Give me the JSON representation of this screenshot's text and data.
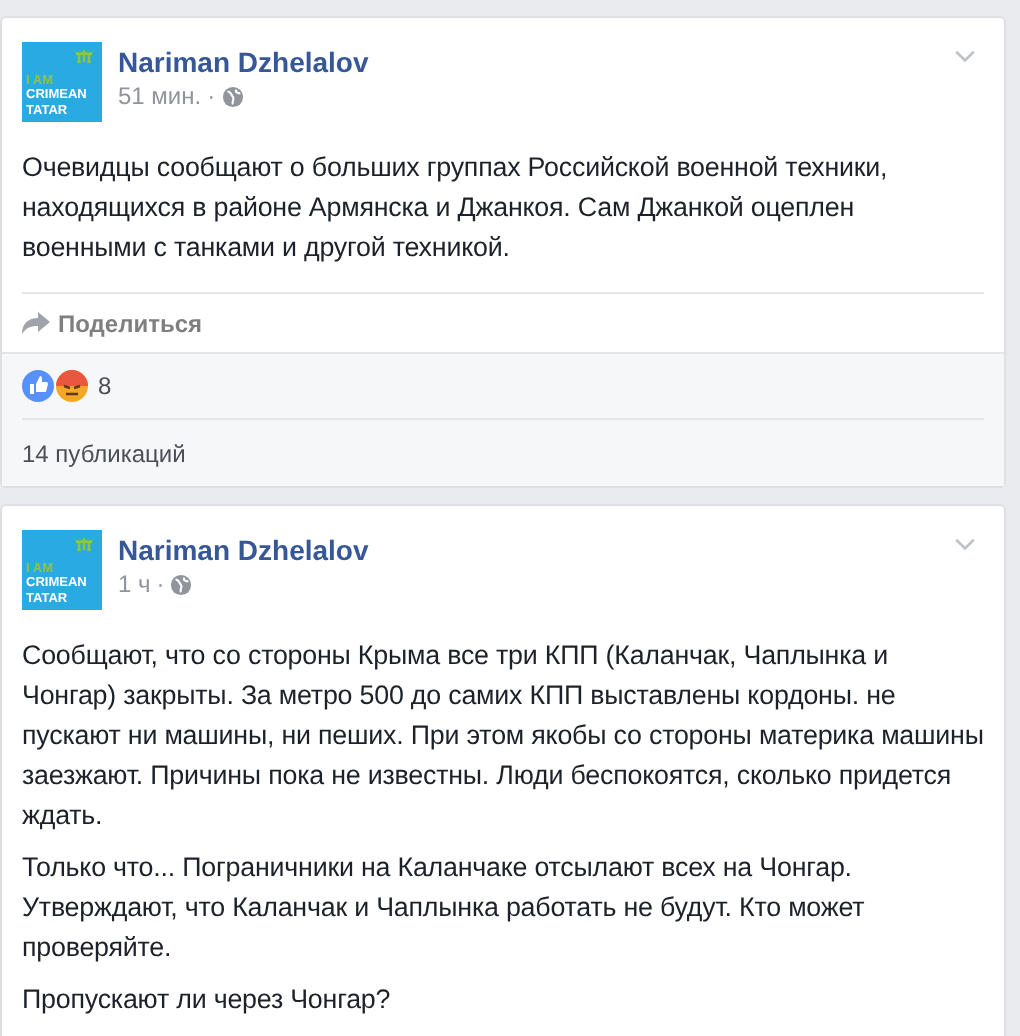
{
  "posts": [
    {
      "author": "Nariman Dzhelalov",
      "avatar_lines": [
        "I AM",
        "CRIMEAN",
        "TATAR"
      ],
      "time": "51 мин.",
      "separator": "·",
      "paragraphs": [
        "Очевидцы сообщают о больших группах Российской военной техники, находящихся в районе Армянска и Джанкоя. Сам Джанкой оцеплен военными с танками и другой техникой."
      ],
      "share_label": "Поделиться",
      "reactions_count": "8",
      "shares_text": "14 публикаций"
    },
    {
      "author": "Nariman Dzhelalov",
      "avatar_lines": [
        "I AM",
        "CRIMEAN",
        "TATAR"
      ],
      "time": "1 ч",
      "separator": "·",
      "paragraphs": [
        "Сообщают, что со стороны Крыма все три КПП (Каланчак, Чаплынка и Чонгар) закрыты. За метро 500 до самих КПП выставлены кордоны. не пускают ни машины, ни пеших. При этом якобы со стороны материка машины заезжают. Причины пока не известны. Люди беспокоятся, сколько придется ждать.",
        "Только что... Пограничники на Каланчаке отсылают всех на Чонгар. Утверждают, что Каланчак и Чаплынка работать не будут. Кто может проверяйте.",
        "Пропускают ли через Чонгар?"
      ]
    }
  ]
}
